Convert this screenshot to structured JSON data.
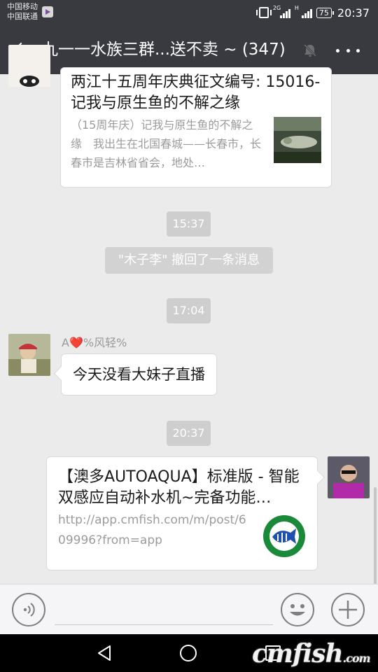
{
  "status_bar": {
    "carrier_1": "中国移动",
    "carrier_2": "中国联通",
    "network_1": "2G",
    "network_2": "H",
    "battery": "75",
    "time": "20:37"
  },
  "header": {
    "title": "九一一水族三群...送不卖 ~ (347)",
    "background_color": "#393a3f"
  },
  "messages": {
    "article_card": {
      "title": "两江十五周年庆典征文编号: 15016- 记我与原生鱼的不解之缘",
      "description": "（15周年庆）记我与原生鱼的不解之缘　我出生在北国春城——长春市，长春市是吉林省省会，地处…"
    },
    "time_1": "15:37",
    "recall_notice": "\"木子李\" 撤回了一条消息",
    "time_2": "17:04",
    "text_message": {
      "sender": "A❤️%风轻%",
      "text": "今天没看大妹子直播"
    },
    "time_3": "20:37",
    "link_card": {
      "title": "【澳多AUTOAQUA】标准版 - 智能双感应自动补水机~完备功能…",
      "url": "http://app.cmfish.com/m/post/609996?from=app"
    }
  },
  "input_bar": {
    "voice_icon": "voice-icon",
    "emoji_icon": "emoji-icon",
    "plus_icon": "plus-icon",
    "input_value": ""
  },
  "watermark": {
    "main": "cmfish",
    "suffix": ".com"
  }
}
